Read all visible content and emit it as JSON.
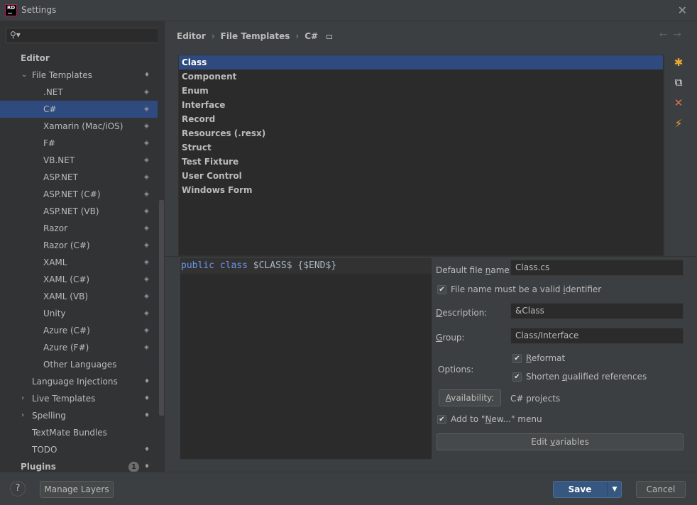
{
  "window": {
    "title": "Settings",
    "logo_text": "RD",
    "close_glyph": "✕"
  },
  "sidebar": {
    "search": {
      "placeholder": "",
      "icon": "search-icon"
    },
    "items": [
      {
        "label": "Editor",
        "level": 0,
        "bold": true,
        "arrow": "",
        "icon": ""
      },
      {
        "label": "File Templates",
        "level": 1,
        "arrow": "⌄",
        "icon": "drop"
      },
      {
        "label": ".NET",
        "level": 2,
        "arrow": "",
        "icon": "layers"
      },
      {
        "label": "C#",
        "level": 2,
        "arrow": "",
        "icon": "layers",
        "selected": true
      },
      {
        "label": "Xamarin (Mac/iOS)",
        "level": 2,
        "arrow": "",
        "icon": "layers"
      },
      {
        "label": "F#",
        "level": 2,
        "arrow": "",
        "icon": "layers"
      },
      {
        "label": "VB.NET",
        "level": 2,
        "arrow": "",
        "icon": "layers"
      },
      {
        "label": "ASP.NET",
        "level": 2,
        "arrow": "",
        "icon": "layers"
      },
      {
        "label": "ASP.NET (C#)",
        "level": 2,
        "arrow": "",
        "icon": "layers"
      },
      {
        "label": "ASP.NET (VB)",
        "level": 2,
        "arrow": "",
        "icon": "layers"
      },
      {
        "label": "Razor",
        "level": 2,
        "arrow": "",
        "icon": "layers"
      },
      {
        "label": "Razor (C#)",
        "level": 2,
        "arrow": "",
        "icon": "layers"
      },
      {
        "label": "XAML",
        "level": 2,
        "arrow": "",
        "icon": "layers"
      },
      {
        "label": "XAML (C#)",
        "level": 2,
        "arrow": "",
        "icon": "layers"
      },
      {
        "label": "XAML (VB)",
        "level": 2,
        "arrow": "",
        "icon": "layers"
      },
      {
        "label": "Unity",
        "level": 2,
        "arrow": "",
        "icon": "layers"
      },
      {
        "label": "Azure (C#)",
        "level": 2,
        "arrow": "",
        "icon": "layers"
      },
      {
        "label": "Azure (F#)",
        "level": 2,
        "arrow": "",
        "icon": "layers"
      },
      {
        "label": "Other Languages",
        "level": 2,
        "arrow": "",
        "icon": ""
      },
      {
        "label": "Language Injections",
        "level": 1,
        "arrow": "",
        "icon": "drop"
      },
      {
        "label": "Live Templates",
        "level": 1,
        "arrow": "›",
        "icon": "drop"
      },
      {
        "label": "Spelling",
        "level": 1,
        "arrow": "›",
        "icon": "drop"
      },
      {
        "label": "TextMate Bundles",
        "level": 1,
        "arrow": "",
        "icon": ""
      },
      {
        "label": "TODO",
        "level": 1,
        "arrow": "",
        "icon": "drop"
      },
      {
        "label": "Plugins",
        "level": 0,
        "bold": true,
        "arrow": "",
        "icon": "drop",
        "badge": "1"
      }
    ]
  },
  "breadcrumb": {
    "items": [
      "Editor",
      "File Templates",
      "C#"
    ],
    "separator": "›"
  },
  "nav": {
    "back": "←",
    "forward": "→"
  },
  "templates": {
    "items": [
      "Class",
      "Component",
      "Enum",
      "Interface",
      "Record",
      "Resources (.resx)",
      "Struct",
      "Test Fixture",
      "User Control",
      "Windows Form"
    ],
    "selected": "Class"
  },
  "tools": {
    "add": "✱",
    "copy": "⧉",
    "delete": "✕",
    "generate": "⚡"
  },
  "editor": {
    "code": {
      "kw1": "public",
      "kw2": "class",
      "rest": " $CLASS$ {$END$}"
    }
  },
  "properties": {
    "default_file_name": {
      "label_pre": "Default file ",
      "label_u": "n",
      "label_post": "ame:",
      "value": "Class.cs"
    },
    "valid_identifier": {
      "pre": "File name must be a valid ",
      "u": "i",
      "post": "dentifier",
      "checked": true
    },
    "description": {
      "label_u": "D",
      "label_post": "escription:",
      "value": "&Class"
    },
    "group": {
      "label_u": "G",
      "label_post": "roup:",
      "value": "Class/Interface"
    },
    "options_label": "Options:",
    "reformat": {
      "u": "R",
      "post": "eformat",
      "checked": true
    },
    "shorten": {
      "pre": "Shorten ",
      "u": "q",
      "post": "ualified references",
      "checked": true
    },
    "availability": {
      "u": "A",
      "post": "vailability:",
      "value": "C# projects"
    },
    "add_to_new": {
      "pre": "Add to \"",
      "u": "N",
      "post": "ew...\" menu",
      "checked": true
    },
    "edit_variables": {
      "pre": "Edit ",
      "u": "v",
      "post": "ariables"
    },
    "check_glyph": "✔"
  },
  "footer": {
    "help": "?",
    "manage_layers": "Manage Layers",
    "save": "Save",
    "save_dropdown": "▼",
    "cancel": "Cancel"
  },
  "colors": {
    "accent": "#2f4a7e",
    "save_button": "#365880",
    "keyword": "#6c95eb",
    "delete_icon": "#e06c5a",
    "lightning_icon": "#f0a732"
  }
}
